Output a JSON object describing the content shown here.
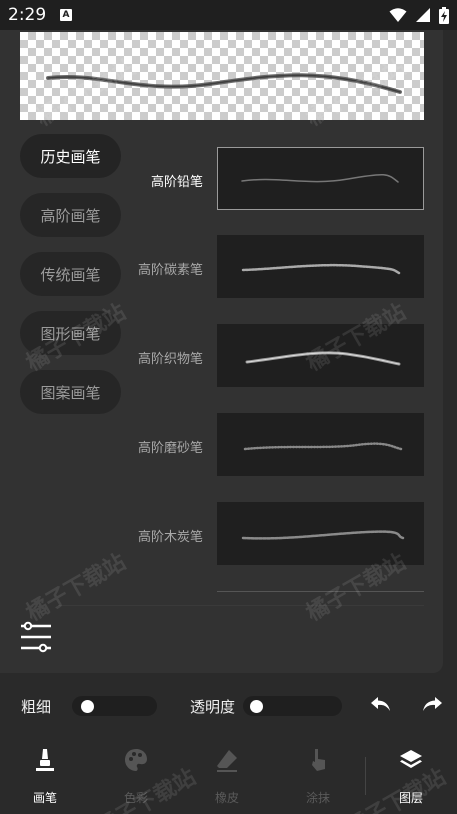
{
  "status_bar": {
    "time": "2:29",
    "app_badge": "A"
  },
  "categories": [
    {
      "label": "历史画笔",
      "active": true
    },
    {
      "label": "高阶画笔",
      "active": false
    },
    {
      "label": "传统画笔",
      "active": false
    },
    {
      "label": "图形画笔",
      "active": false
    },
    {
      "label": "图案画笔",
      "active": false
    }
  ],
  "brushes": [
    {
      "label": "高阶铅笔",
      "active": true
    },
    {
      "label": "高阶碳素笔",
      "active": false
    },
    {
      "label": "高阶织物笔",
      "active": false
    },
    {
      "label": "高阶磨砂笔",
      "active": false
    },
    {
      "label": "高阶木炭笔",
      "active": false
    }
  ],
  "controls": {
    "thickness_label": "粗细",
    "thickness_value": 0.0,
    "opacity_label": "透明度",
    "opacity_value": 0.0
  },
  "nav": [
    {
      "label": "画笔",
      "icon": "brush-icon",
      "active": true
    },
    {
      "label": "色彩",
      "icon": "palette-icon",
      "active": false
    },
    {
      "label": "橡皮",
      "icon": "eraser-icon",
      "active": false
    },
    {
      "label": "涂抹",
      "icon": "smudge-finger-icon",
      "active": false
    },
    {
      "label": "图层",
      "icon": "layers-icon",
      "active": true
    }
  ],
  "watermark": "橘子下载站",
  "colors": {
    "background": "#2a2a2a",
    "panel": "#323232",
    "accent": "#ffffff"
  }
}
